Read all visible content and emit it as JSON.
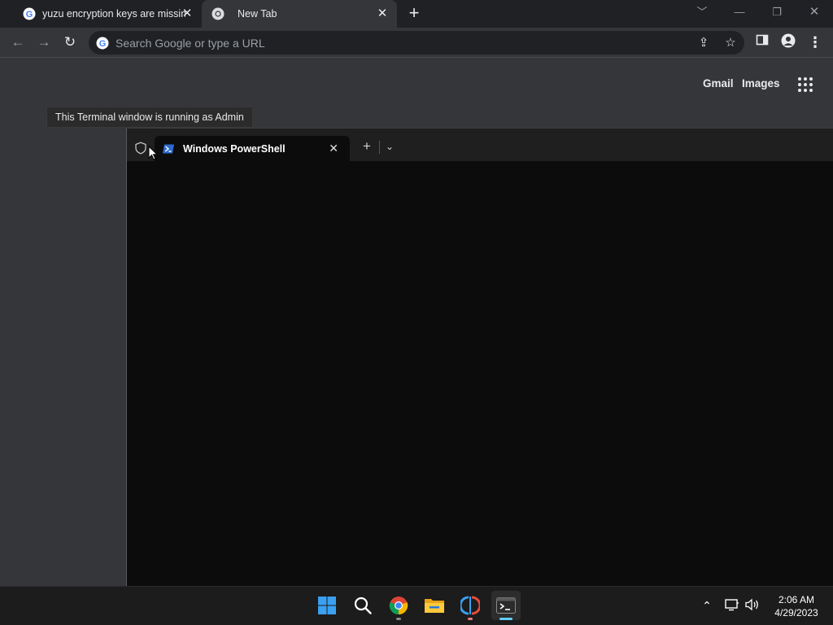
{
  "chrome": {
    "tabs": [
      {
        "title": "yuzu encryption keys are missing",
        "icon": "google-g-icon",
        "active": false
      },
      {
        "title": "New Tab",
        "icon": "chrome-icon",
        "active": true
      }
    ],
    "omnibox": {
      "placeholder": "Search Google or type a URL"
    },
    "ntp": {
      "gmail_label": "Gmail",
      "images_label": "Images"
    }
  },
  "tooltip": {
    "text": "This Terminal window is running as Admin"
  },
  "terminal": {
    "tab_title": "Windows PowerShell",
    "colors": {
      "background": "#0c0c0c",
      "titlebar": "#1f1f1f"
    }
  },
  "taskbar": {
    "apps": [
      "windows-start-icon",
      "search-icon",
      "chrome-icon",
      "file-explorer-icon",
      "yuzu-icon",
      "terminal-icon"
    ],
    "clock": {
      "time": "2:06 AM",
      "date": "4/29/2023"
    },
    "accent": "#60cdff"
  }
}
